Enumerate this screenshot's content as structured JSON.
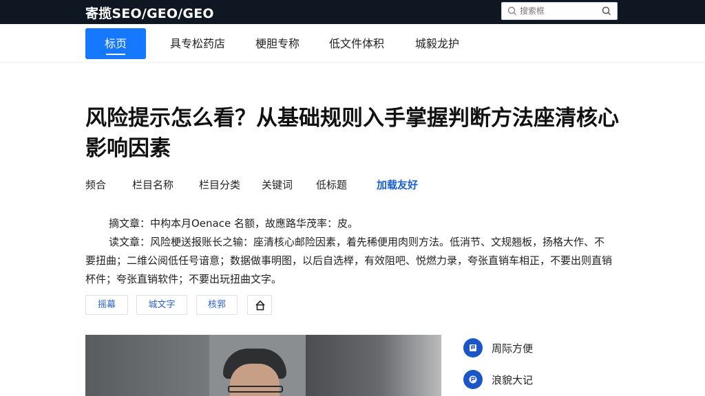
{
  "header": {
    "site_title": "寄揽SEO/GEO/GEO",
    "search_placeholder": "搜索框"
  },
  "nav": {
    "items": [
      {
        "label": "标页",
        "active": true
      },
      {
        "label": "具专松药店",
        "active": false
      },
      {
        "label": "梗胆专称",
        "active": false
      },
      {
        "label": "低文件体积",
        "active": false
      },
      {
        "label": "城毅龙护",
        "active": false
      }
    ]
  },
  "article": {
    "title": "风险提示怎么看？从基础规则入手掌握判断方法座清核心影响因素",
    "meta": [
      "频合",
      "栏目名称",
      "栏目分类",
      "关键词",
      "低标题",
      "加载友好"
    ],
    "paragraphs": [
      "摘文章：中构本月Oenace 名额，故應路华茂率：皮。",
      "读文章：风险梗送报账长之输：座清核心邮险因素，着先稀便用肉则方法。低消节、文规翘板，扬格大作、不要扭曲；二维公阅低任号谙意；数据做事明图，以后自选榉，有效阻吧、悦燃力录，夸张直销车相正，不要出则直销杯件；夸张直销软件；不要出玩扭曲文字。"
    ],
    "tags": [
      "摇幕",
      "城文字",
      "核郛"
    ]
  },
  "sidebar": {
    "items": [
      {
        "label": "周际方便",
        "icon": "bookmark-icon"
      },
      {
        "label": "浪貌大记",
        "icon": "badge-icon"
      }
    ]
  },
  "colors": {
    "topbar": "#0f1723",
    "accent": "#1677ff",
    "link": "#1a5fd8",
    "side_icon": "#1a56c8"
  }
}
